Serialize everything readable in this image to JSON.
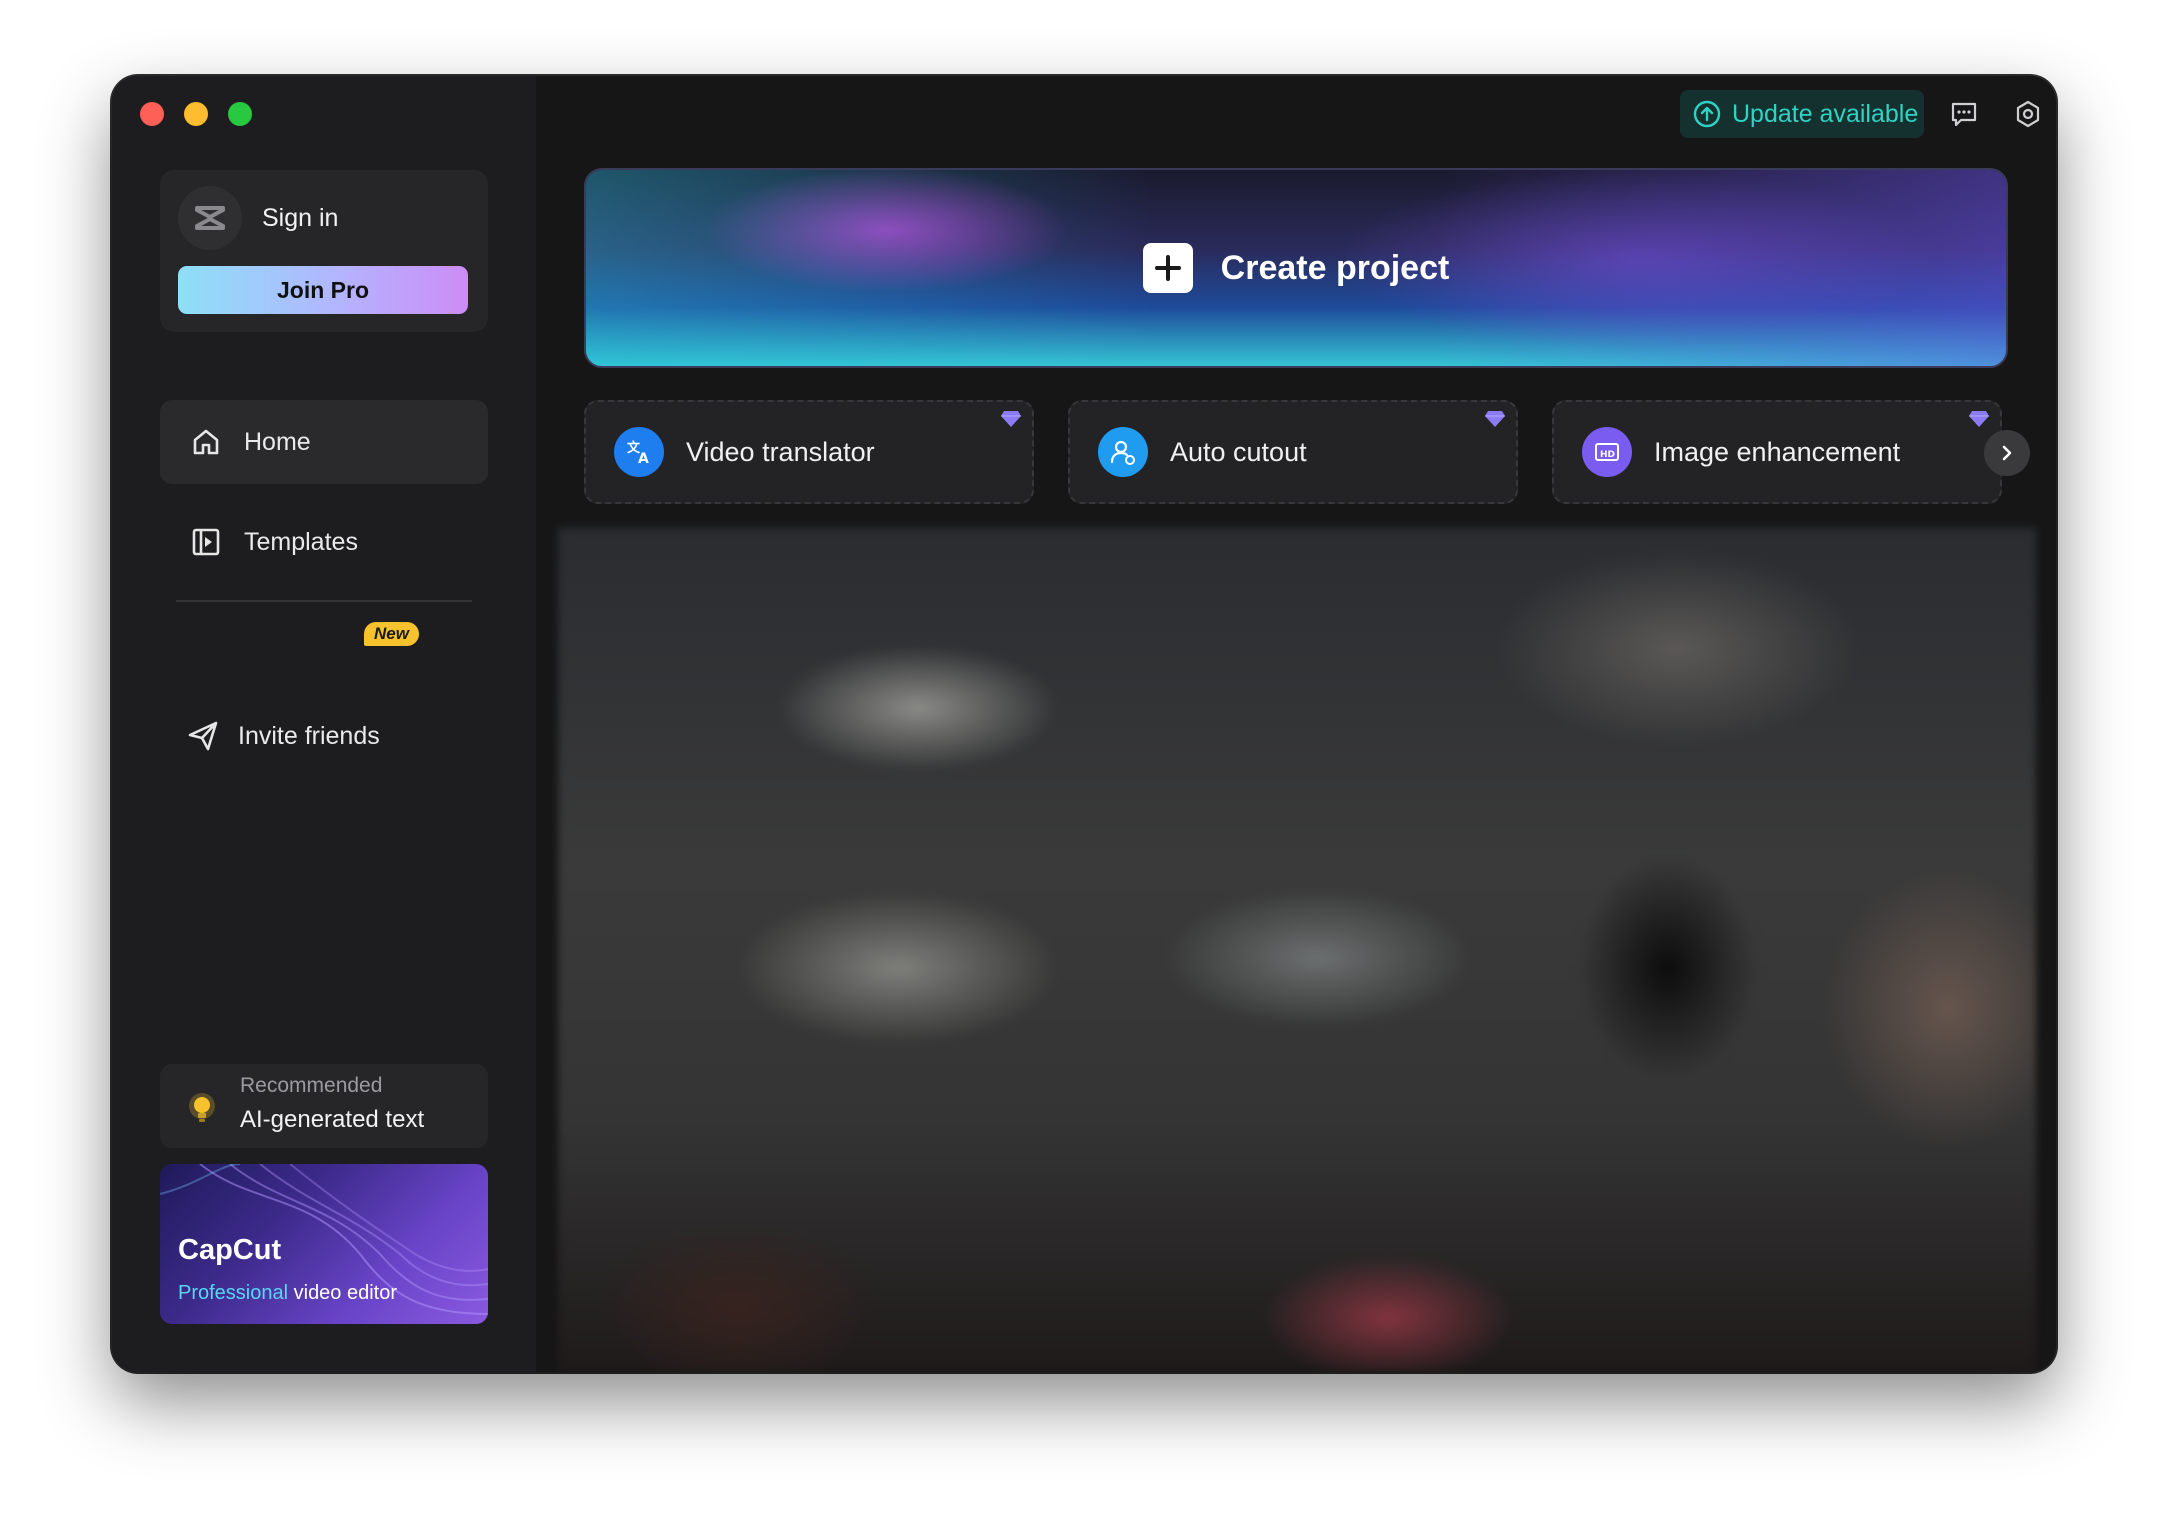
{
  "window": {
    "traffic_lights": [
      "close",
      "minimize",
      "zoom"
    ]
  },
  "sidebar": {
    "signin_label": "Sign in",
    "join_pro_label": "Join Pro",
    "nav": [
      {
        "label": "Home",
        "icon": "home-icon",
        "active": true
      },
      {
        "label": "Templates",
        "icon": "templates-icon",
        "active": false
      },
      {
        "label": "Invite friends",
        "icon": "send-icon",
        "badge": "New"
      }
    ],
    "recommended": {
      "caption": "Recommended",
      "title": "AI-generated text",
      "icon": "lightbulb-icon"
    },
    "promo": {
      "title": "CapCut",
      "subtitle_accent": "Professional",
      "subtitle_rest": " video editor"
    }
  },
  "topbar": {
    "update_label": "Update available",
    "update_icon": "arrow-up-circle-icon",
    "feedback_icon": "feedback-icon",
    "settings_icon": "settings-icon"
  },
  "main": {
    "create_label": "Create project",
    "tools": [
      {
        "label": "Video translator",
        "icon": "translate-icon",
        "color": "#1e7ef0",
        "premium": true
      },
      {
        "label": "Auto cutout",
        "icon": "person-cutout-icon",
        "color": "#1f9cf0",
        "premium": true
      },
      {
        "label": "Image enhancement",
        "icon": "hd-icon",
        "color": "#7a5cf0",
        "premium": true
      }
    ]
  },
  "colors": {
    "accent_teal": "#2fd3c4",
    "badge_yellow": "#f7c22d",
    "premium_gem": "#8b7cf6"
  }
}
